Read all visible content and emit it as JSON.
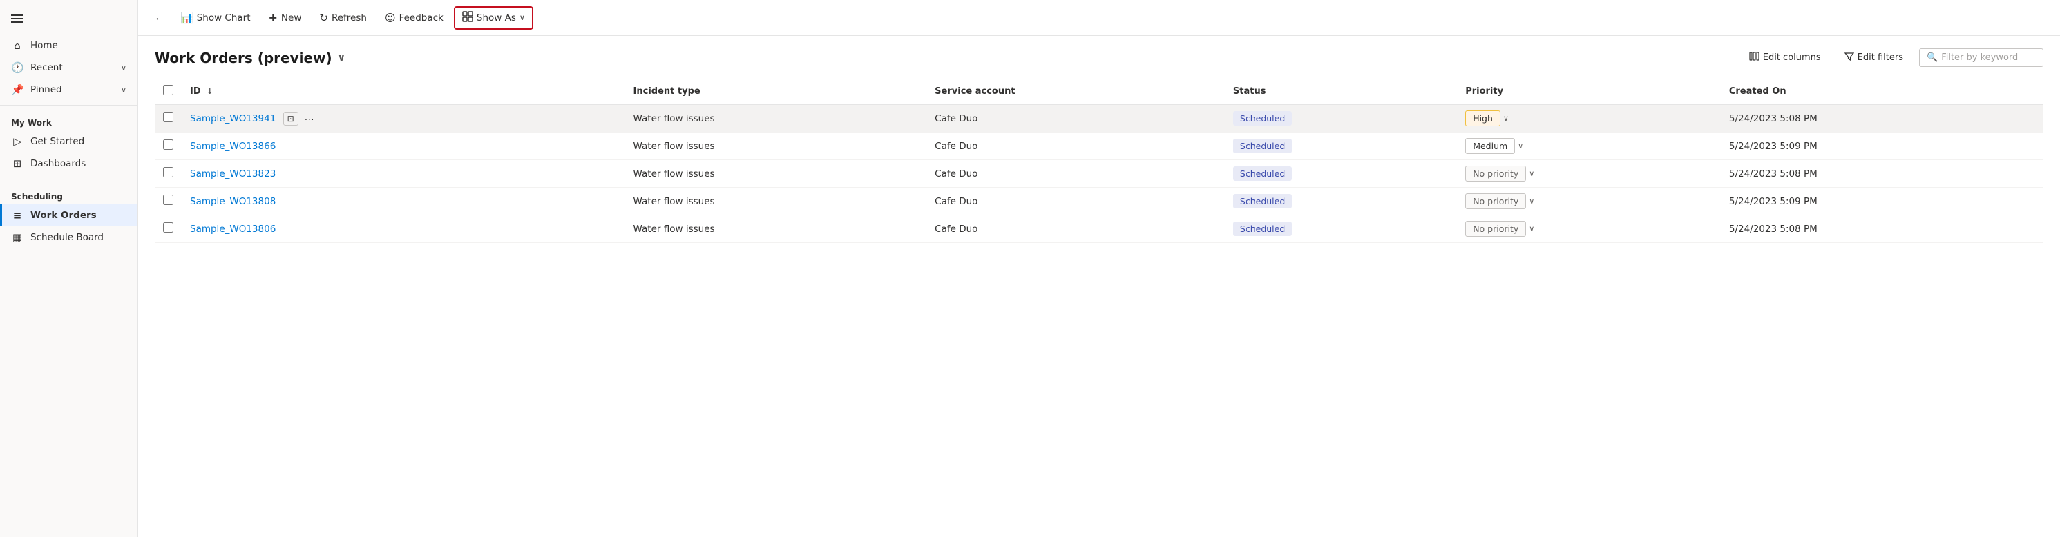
{
  "sidebar": {
    "items": [
      {
        "id": "home",
        "label": "Home",
        "icon": "🏠",
        "hasChevron": false
      },
      {
        "id": "recent",
        "label": "Recent",
        "icon": "🕐",
        "hasChevron": true
      },
      {
        "id": "pinned",
        "label": "Pinned",
        "icon": "📌",
        "hasChevron": true
      }
    ],
    "mywork_label": "My Work",
    "mywork_items": [
      {
        "id": "get-started",
        "label": "Get Started",
        "icon": "▷"
      },
      {
        "id": "dashboards",
        "label": "Dashboards",
        "icon": "⊞"
      }
    ],
    "scheduling_label": "Scheduling",
    "scheduling_items": [
      {
        "id": "work-orders",
        "label": "Work Orders",
        "icon": "📋",
        "active": true
      },
      {
        "id": "schedule-board",
        "label": "Schedule Board",
        "icon": "📅"
      }
    ]
  },
  "toolbar": {
    "back_label": "←",
    "show_chart_label": "Show Chart",
    "new_label": "New",
    "refresh_label": "Refresh",
    "feedback_label": "Feedback",
    "show_as_label": "Show As"
  },
  "content": {
    "title": "Work Orders (preview)",
    "edit_columns_label": "Edit columns",
    "edit_filters_label": "Edit filters",
    "filter_placeholder": "Filter by keyword",
    "columns": [
      {
        "id": "id",
        "label": "ID",
        "sort": true
      },
      {
        "id": "incident_type",
        "label": "Incident type"
      },
      {
        "id": "service_account",
        "label": "Service account"
      },
      {
        "id": "status",
        "label": "Status"
      },
      {
        "id": "priority",
        "label": "Priority"
      },
      {
        "id": "created_on",
        "label": "Created On"
      }
    ],
    "rows": [
      {
        "id": "Sample_WO13941",
        "incident_type": "Water flow issues",
        "service_account": "Cafe Duo",
        "status": "Scheduled",
        "priority": "High",
        "priority_class": "high",
        "created_on": "5/24/2023 5:08 PM",
        "hovered": true
      },
      {
        "id": "Sample_WO13866",
        "incident_type": "Water flow issues",
        "service_account": "Cafe Duo",
        "status": "Scheduled",
        "priority": "Medium",
        "priority_class": "medium",
        "created_on": "5/24/2023 5:09 PM",
        "hovered": false
      },
      {
        "id": "Sample_WO13823",
        "incident_type": "Water flow issues",
        "service_account": "Cafe Duo",
        "status": "Scheduled",
        "priority": "No priority",
        "priority_class": "no-priority",
        "created_on": "5/24/2023 5:08 PM",
        "hovered": false
      },
      {
        "id": "Sample_WO13808",
        "incident_type": "Water flow issues",
        "service_account": "Cafe Duo",
        "status": "Scheduled",
        "priority": "No priority",
        "priority_class": "no-priority",
        "created_on": "5/24/2023 5:09 PM",
        "hovered": false
      },
      {
        "id": "Sample_WO13806",
        "incident_type": "Water flow issues",
        "service_account": "Cafe Duo",
        "status": "Scheduled",
        "priority": "No priority",
        "priority_class": "no-priority",
        "created_on": "5/24/2023 5:08 PM",
        "hovered": false
      }
    ]
  },
  "icons": {
    "hamburger": "☰",
    "home": "⌂",
    "clock": "○",
    "pin": "⊿",
    "play": "▷",
    "grid": "⊞",
    "list": "≡",
    "calendar": "▦",
    "back_arrow": "←",
    "chart": "📊",
    "plus": "+",
    "refresh": "↻",
    "feedback": "☺",
    "show_as": "⊟",
    "chevron_down": "∨",
    "edit_cols": "⊟",
    "filter_funnel": "▽",
    "search": "🔍",
    "open_record": "⊡",
    "dots": "···"
  }
}
